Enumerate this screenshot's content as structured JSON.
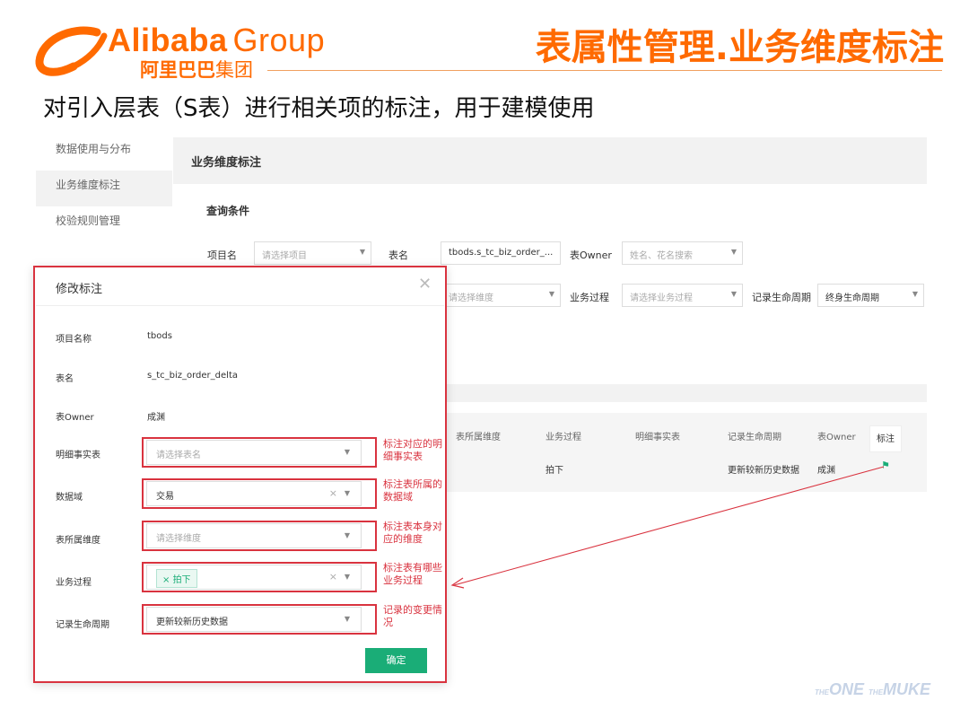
{
  "header": {
    "logo_en": "Alibaba",
    "logo_group": "Group",
    "logo_cn_bold": "阿里巴巴",
    "logo_cn_thin": "集团",
    "title": "表属性管理.业务维度标注",
    "subtitle": "对引入层表（S表）进行相关项的标注，用于建模使用"
  },
  "sidebar": {
    "items": [
      {
        "label": "数据使用与分布"
      },
      {
        "label": "业务维度标注"
      },
      {
        "label": "校验规则管理"
      }
    ]
  },
  "page": {
    "breadcrumb": "业务维度标注",
    "query_title": "查询条件",
    "filters": {
      "project_label": "项目名",
      "project_placeholder": "请选择项目",
      "table_label": "表名",
      "table_value": "tbods.s_tc_biz_order_...",
      "owner_label": "表Owner",
      "owner_placeholder": "姓名、花名搜索",
      "dim_placeholder": "请选择维度",
      "process_label": "业务过程",
      "process_placeholder": "请选择业务过程",
      "lifecycle_label": "记录生命周期",
      "lifecycle_value": "终身生命周期"
    },
    "table": {
      "headers": [
        "表所属维度",
        "业务过程",
        "明细事实表",
        "记录生命周期",
        "表Owner"
      ],
      "action_header": "标注",
      "row": {
        "process": "拍下",
        "lifecycle": "更新较新历史数据",
        "owner": "成渊"
      }
    }
  },
  "modal": {
    "title": "修改标注",
    "project_label": "项目名称",
    "project_value": "tbods",
    "table_label": "表名",
    "table_value": "s_tc_biz_order_delta",
    "owner_label": "表Owner",
    "owner_value": "成渊",
    "fact_label": "明细事实表",
    "fact_placeholder": "请选择表名",
    "domain_label": "数据域",
    "domain_value": "交易",
    "dim_label": "表所属维度",
    "dim_placeholder": "请选择维度",
    "process_label": "业务过程",
    "process_tag": "拍下",
    "lifecycle_label": "记录生命周期",
    "lifecycle_value": "更新较新历史数据",
    "ok_label": "确定"
  },
  "annotations": {
    "fact": "标注对应的明细事实表",
    "domain": "标注表所属的数据域",
    "dim": "标注表本身对应的维度",
    "process": "标注表有哪些业务过程",
    "lifecycle": "记录的变更情况"
  },
  "watermark": {
    "pre": "THE",
    "one": "ONE",
    "mid": "THE",
    "muke": "MUKE"
  },
  "colors": {
    "brand_orange": "#ff6a00",
    "highlight_red": "#d9333f",
    "primary_green": "#1aad77"
  },
  "icons": [
    "alibaba-logo-icon",
    "close-icon",
    "chevron-down-icon",
    "clear-icon",
    "flag-icon"
  ]
}
